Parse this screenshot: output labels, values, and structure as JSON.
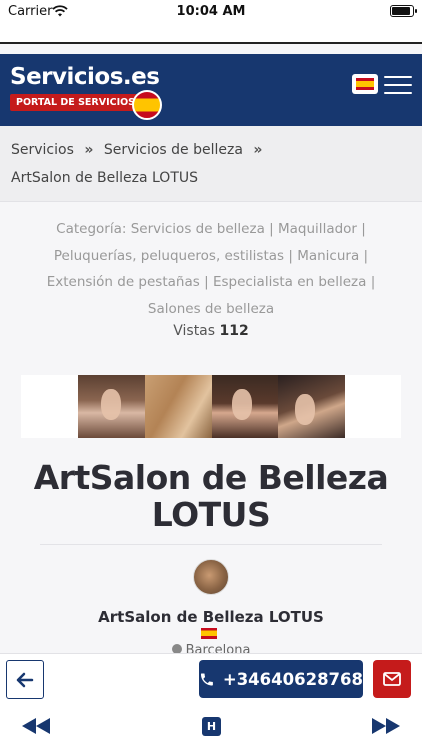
{
  "status_bar": {
    "carrier": "Carrier",
    "time": "10:04 AM",
    "icons": [
      "wifi-icon",
      "battery-icon"
    ]
  },
  "header": {
    "logo_title": "Servicios.es",
    "logo_subtitle": "PORTAL DE SERVICIOS",
    "language": "Spanish flag",
    "menu_icon": "hamburger-menu-icon",
    "colors": {
      "header_bg": "#17376f",
      "accent_red": "#c51b1b"
    }
  },
  "breadcrumb": {
    "items": [
      "Servicios",
      "Servicios de belleza",
      "ArtSalon de Belleza LOTUS"
    ],
    "separator": "»"
  },
  "categories": {
    "label": "Categoría:",
    "items": [
      "Servicios de belleza",
      "Maquillador",
      "Peluquerías, peluqueros, estilistas",
      "Manicura",
      "Extensión de pestañas",
      "Especialista en belleza",
      "Salones de belleza"
    ],
    "separator": "|"
  },
  "views": {
    "label": "Vistas",
    "count": "112"
  },
  "title": "ArtSalon de Belleza LOTUS",
  "profile": {
    "name": "ArtSalon de Belleza LOTUS",
    "location": "Barcelona"
  },
  "bottom_bar": {
    "phone": "+34640628768",
    "back_icon": "arrow-left-icon",
    "phone_icon": "phone-icon",
    "mail_icon": "mail-icon",
    "home_label": "H",
    "prev_icon": "rewind-icon",
    "next_icon": "fast-forward-icon"
  }
}
